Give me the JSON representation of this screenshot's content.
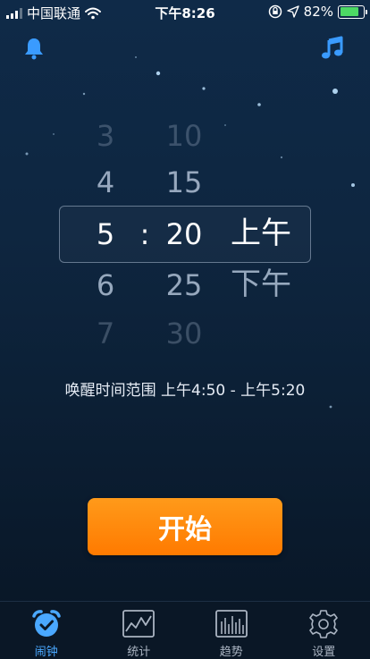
{
  "status_bar": {
    "carrier": "中国联通",
    "time": "下午8:26",
    "battery_percent": "82%",
    "battery_level": 0.82
  },
  "header": {
    "left_icon": "bell-icon",
    "right_icon": "music-note-icon",
    "accent_color": "#3a9bff"
  },
  "picker": {
    "hours": [
      "3",
      "4",
      "5",
      "6",
      "7"
    ],
    "minutes": [
      "10",
      "15",
      "20",
      "25",
      "30"
    ],
    "ampm": [
      "上午",
      "下午"
    ],
    "separator": ":",
    "selected": {
      "hour": "5",
      "minute": "20",
      "ampm": "上午"
    }
  },
  "wake_range_text": "唤醒时间范围 上午4:50 - 上午5:20",
  "start_button": {
    "label": "开始",
    "color": "#ff8a00"
  },
  "tabs": [
    {
      "label": "闹钟",
      "icon": "alarm-clock-icon",
      "active": true
    },
    {
      "label": "统计",
      "icon": "line-chart-icon",
      "active": false
    },
    {
      "label": "趋势",
      "icon": "bar-chart-icon",
      "active": false
    },
    {
      "label": "设置",
      "icon": "gear-icon",
      "active": false
    }
  ]
}
